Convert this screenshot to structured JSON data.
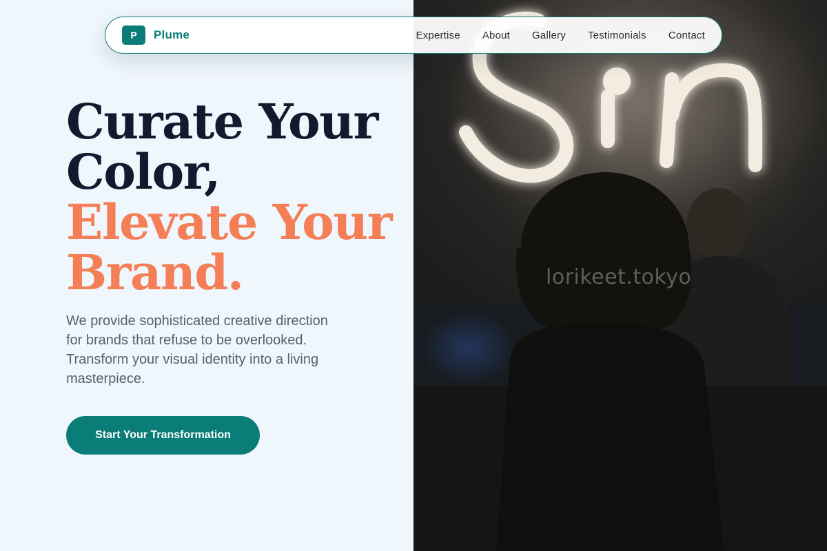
{
  "brand": {
    "logo_letter": "P",
    "name": "Plume",
    "color": "#0b7d78"
  },
  "nav": {
    "links": [
      {
        "label": "Expertise"
      },
      {
        "label": "About"
      },
      {
        "label": "Gallery"
      },
      {
        "label": "Testimonials"
      },
      {
        "label": "Contact"
      }
    ]
  },
  "hero": {
    "headline_line1": "Curate Your",
    "headline_line2": "Color,",
    "headline_accent_line1": "Elevate Your",
    "headline_accent_line2": "Brand.",
    "lead": "We provide sophisticated creative direction for brands that refuse to be overlooked. Transform your visual identity into a living masterpiece.",
    "cta_label": "Start Your Transformation",
    "image_watermark": "lorikeet.tokyo"
  },
  "colors": {
    "accent": "#f47e56",
    "primary": "#0b7d78",
    "heading": "#111a2e",
    "background": "#eff6fc"
  }
}
